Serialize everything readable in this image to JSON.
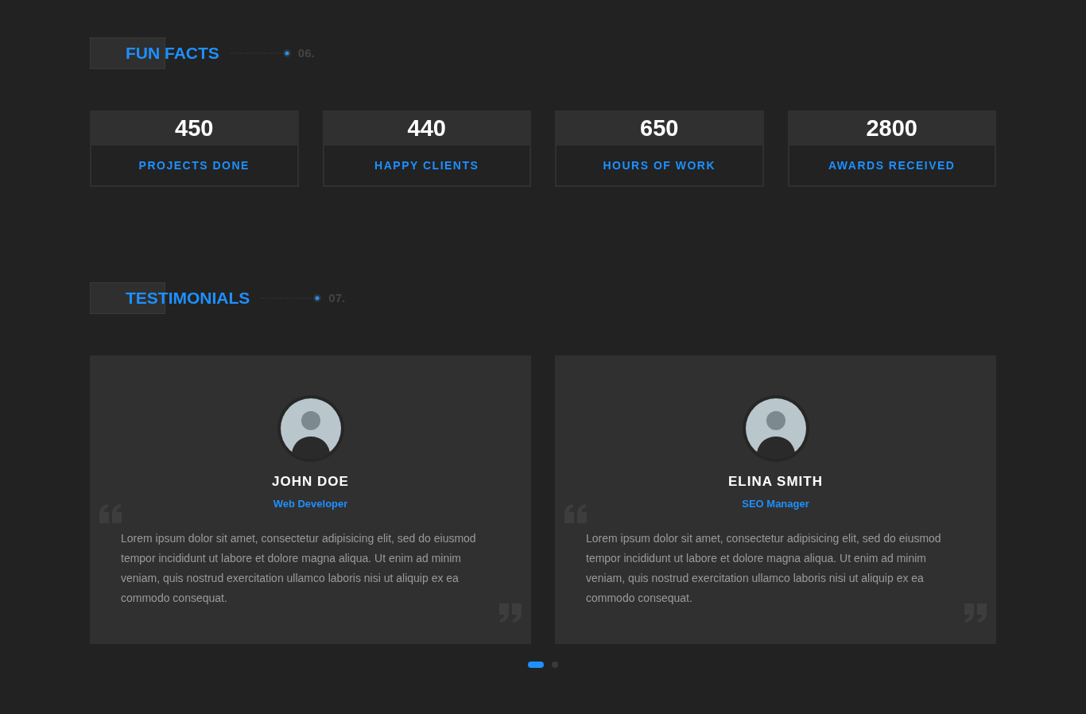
{
  "fun_facts": {
    "heading": "FUN FACTS",
    "number": "06.",
    "stats": [
      {
        "value": "450",
        "label": "PROJECTS DONE"
      },
      {
        "value": "440",
        "label": "HAPPY CLIENTS"
      },
      {
        "value": "650",
        "label": "HOURS OF WORK"
      },
      {
        "value": "2800",
        "label": "AWARDS RECEIVED"
      }
    ]
  },
  "testimonials": {
    "heading": "TESTIMONIALS",
    "number": "07.",
    "items": [
      {
        "name": "JOHN DOE",
        "role": "Web Developer",
        "quote": "Lorem ipsum dolor sit amet, consectetur adipisicing elit, sed do eiusmod tempor incididunt ut labore et dolore magna aliqua. Ut enim ad minim veniam, quis nostrud exercitation ullamco laboris nisi ut aliquip ex ea commodo consequat."
      },
      {
        "name": "ELINA SMITH",
        "role": "SEO Manager",
        "quote": "Lorem ipsum dolor sit amet, consectetur adipisicing elit, sed do eiusmod tempor incididunt ut labore et dolore magna aliqua. Ut enim ad minim veniam, quis nostrud exercitation ullamco laboris nisi ut aliquip ex ea commodo consequat."
      }
    ],
    "dots": [
      {
        "selected": true
      },
      {
        "selected": false
      }
    ]
  }
}
